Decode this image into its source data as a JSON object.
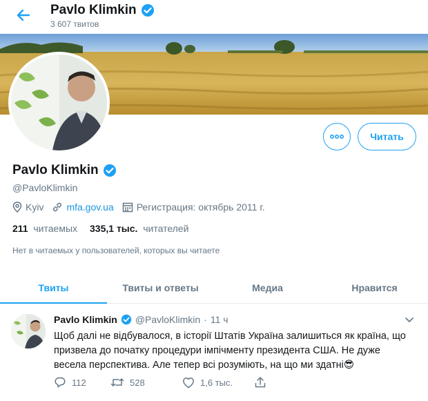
{
  "header": {
    "name": "Pavlo Klimkin",
    "tweet_count": "3 607 твитов"
  },
  "profile": {
    "name": "Pavlo Klimkin",
    "handle": "@PavloKlimkin",
    "location": "Kyiv",
    "website": "mfa.gov.ua",
    "joined": "Регистрация: октябрь 2011 г.",
    "following_count": "211",
    "following_label": "читаемых",
    "followers_count": "335,1 тыс.",
    "followers_label": "читателей",
    "followed_by_note": "Нет в читаемых у пользователей, которых вы читаете"
  },
  "buttons": {
    "follow": "Читать"
  },
  "tabs": [
    {
      "label": "Твиты",
      "active": true
    },
    {
      "label": "Твиты и ответы",
      "active": false
    },
    {
      "label": "Медиа",
      "active": false
    },
    {
      "label": "Нравится",
      "active": false
    }
  ],
  "tweet": {
    "name": "Pavlo Klimkin",
    "handle": "@PavloKlimkin",
    "separator": "·",
    "time": "11 ч",
    "text": "Щоб далі не відбувалося, в історії Штатів Україна залишиться як країна, що призвела до початку процедури імпічменту президента США. Не дуже весела перспектива. Але тепер всі розуміють, на що ми здатні😎",
    "replies": "112",
    "retweets": "528",
    "likes": "1,6 тыс."
  },
  "colors": {
    "accent": "#1da1f2",
    "muted": "#657786",
    "text": "#14171a",
    "verified": "#1da1f2"
  },
  "icons": [
    "back-arrow-icon",
    "verified-icon",
    "more-icon",
    "location-icon",
    "link-icon",
    "calendar-icon",
    "chevron-down-icon",
    "reply-icon",
    "retweet-icon",
    "like-icon",
    "share-icon"
  ]
}
